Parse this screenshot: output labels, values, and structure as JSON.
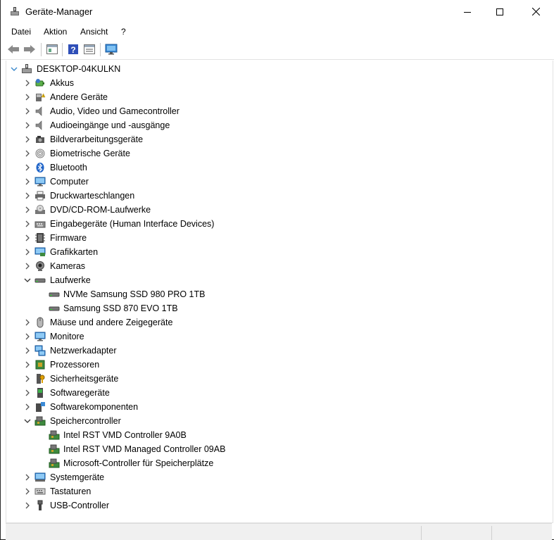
{
  "window": {
    "title": "Geräte-Manager"
  },
  "menu": {
    "items": [
      "Datei",
      "Aktion",
      "Ansicht",
      "?"
    ]
  },
  "toolbar": {
    "buttons": [
      "back-icon",
      "forward-icon",
      "properties-view-icon",
      "help-icon",
      "details-view-icon",
      "monitor-icon"
    ]
  },
  "tree": {
    "root": "DESKTOP-04KULKN",
    "categories": [
      {
        "label": "Akkus",
        "icon": "battery-icon"
      },
      {
        "label": "Andere Geräte",
        "icon": "unknown-device-icon"
      },
      {
        "label": "Audio, Video und Gamecontroller",
        "icon": "speaker-icon"
      },
      {
        "label": "Audioeingänge und -ausgänge",
        "icon": "speaker-icon"
      },
      {
        "label": "Bildverarbeitungsgeräte",
        "icon": "camera-icon"
      },
      {
        "label": "Biometrische Geräte",
        "icon": "fingerprint-icon"
      },
      {
        "label": "Bluetooth",
        "icon": "bluetooth-icon"
      },
      {
        "label": "Computer",
        "icon": "computer-icon"
      },
      {
        "label": "Druckwarteschlangen",
        "icon": "printer-icon"
      },
      {
        "label": "DVD/CD-ROM-Laufwerke",
        "icon": "dvd-icon"
      },
      {
        "label": "Eingabegeräte (Human Interface Devices)",
        "icon": "hid-icon"
      },
      {
        "label": "Firmware",
        "icon": "firmware-icon"
      },
      {
        "label": "Grafikkarten",
        "icon": "display-adapter-icon"
      },
      {
        "label": "Kameras",
        "icon": "webcam-icon"
      },
      {
        "label": "Laufwerke",
        "icon": "disk-icon",
        "expanded": true,
        "children": [
          "NVMe Samsung SSD 980 PRO 1TB",
          "Samsung SSD 870 EVO 1TB"
        ]
      },
      {
        "label": "Mäuse und andere Zeigegeräte",
        "icon": "mouse-icon"
      },
      {
        "label": "Monitore",
        "icon": "monitor-icon"
      },
      {
        "label": "Netzwerkadapter",
        "icon": "network-icon"
      },
      {
        "label": "Prozessoren",
        "icon": "processor-icon"
      },
      {
        "label": "Sicherheitsgeräte",
        "icon": "security-key-icon"
      },
      {
        "label": "Softwaregeräte",
        "icon": "software-device-icon"
      },
      {
        "label": "Softwarekomponenten",
        "icon": "software-component-icon"
      },
      {
        "label": "Speichercontroller",
        "icon": "storage-controller-icon",
        "expanded": true,
        "children": [
          "Intel RST VMD Controller 9A0B",
          "Intel RST VMD Managed Controller 09AB",
          "Microsoft-Controller für Speicherplätze"
        ]
      },
      {
        "label": "Systemgeräte",
        "icon": "system-device-icon"
      },
      {
        "label": "Tastaturen",
        "icon": "keyboard-icon"
      },
      {
        "label": "USB-Controller",
        "icon": "usb-icon"
      }
    ]
  },
  "colors": {
    "selection": "#cce8ff",
    "accent_blue": "#0078d7"
  }
}
